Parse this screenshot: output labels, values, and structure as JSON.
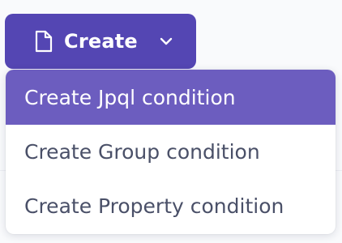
{
  "create_button": {
    "label": "Create",
    "icon": "file-icon",
    "dropdown_icon": "chevron-down-icon"
  },
  "menu": {
    "items": [
      {
        "label": "Create Jpql condition",
        "highlighted": true
      },
      {
        "label": "Create Group condition",
        "highlighted": false
      },
      {
        "label": "Create Property condition",
        "highlighted": false
      }
    ]
  },
  "colors": {
    "button_bg": "#5446b3",
    "highlight_bg": "#6c5dbf",
    "item_text": "#4a5068"
  }
}
